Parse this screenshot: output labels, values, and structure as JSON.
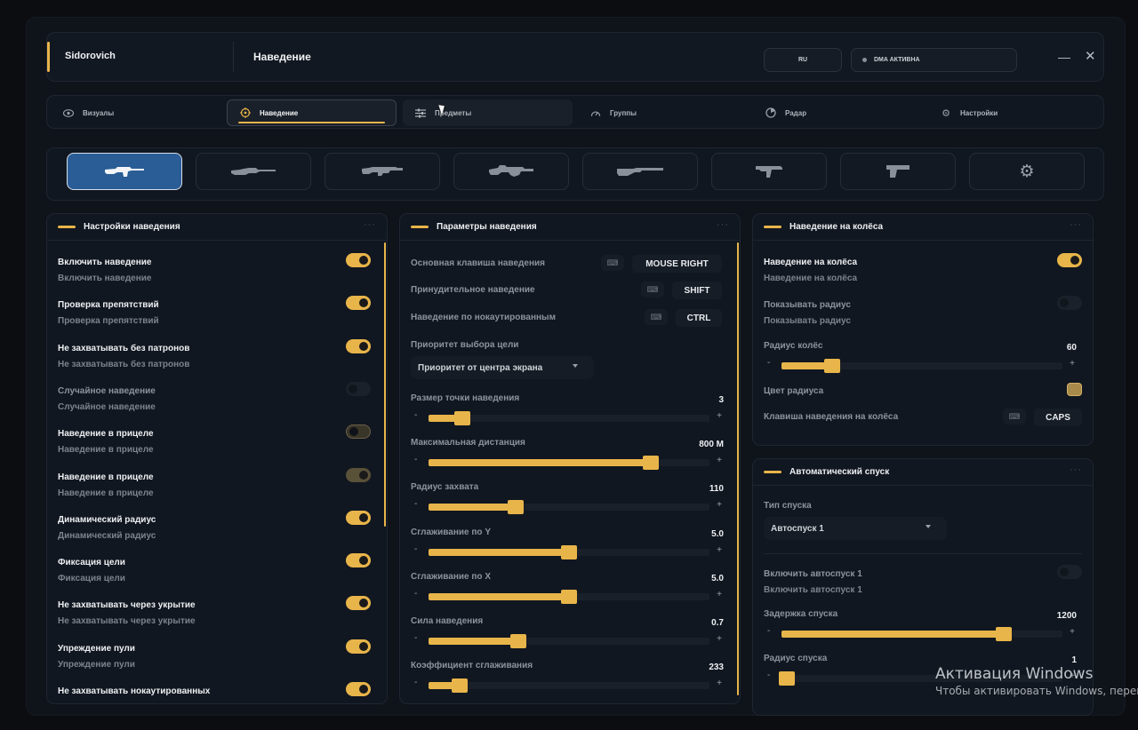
{
  "app": {
    "brand": "Sidorovich",
    "page_title": "Наведение"
  },
  "header": {
    "lang": "RU",
    "dma_status": "DMA АКТИВНА",
    "minimize": "—",
    "close": "✕"
  },
  "nav": [
    {
      "label": "Визуалы",
      "icon": "eye-icon"
    },
    {
      "label": "Наведение",
      "icon": "crosshair-icon"
    },
    {
      "label": "Предметы",
      "icon": "sliders-icon"
    },
    {
      "label": "Группы",
      "icon": "gauge-icon"
    },
    {
      "label": "Радар",
      "icon": "radar-icon"
    },
    {
      "label": "Настройки",
      "icon": "gear-icon"
    }
  ],
  "weapons": [
    "assault-rifle-icon",
    "sniper-rifle-icon",
    "shotgun-icon",
    "machine-gun-icon",
    "long-rifle-icon",
    "smg-icon",
    "pistol-icon",
    "gear-icon"
  ],
  "aim_settings": {
    "title": "Настройки наведения",
    "items": [
      {
        "title": "Включить наведение",
        "subtitle": "Включить наведение",
        "state": "on"
      },
      {
        "title": "Проверка препятствий",
        "subtitle": "Проверка препятствий",
        "state": "on"
      },
      {
        "title": "Не захватывать без патронов",
        "subtitle": "Не захватывать без патронов",
        "state": "on"
      },
      {
        "title": "Случайное наведение",
        "subtitle": "Случайное наведение",
        "state": "off"
      },
      {
        "title": "Наведение в прицеле",
        "subtitle": "Наведение в прицеле",
        "state": "mid"
      },
      {
        "title": "Наведение в прицеле",
        "subtitle": "Наведение в прицеле",
        "state": "mid2"
      },
      {
        "title": "Динамический радиус",
        "subtitle": "Динамический радиус",
        "state": "on"
      },
      {
        "title": "Фиксация цели",
        "subtitle": "Фиксация цели",
        "state": "on"
      },
      {
        "title": "Не захватывать через укрытие",
        "subtitle": "Не захватывать через укрытие",
        "state": "on"
      },
      {
        "title": "Упреждение пули",
        "subtitle": "Упреждение пули",
        "state": "on"
      },
      {
        "title": "Не захватывать нокаутированных",
        "subtitle": "",
        "state": "on"
      }
    ]
  },
  "aim_params": {
    "title": "Параметры наведения",
    "keys": [
      {
        "label": "Основная клавиша наведения",
        "value": "MOUSE RIGHT"
      },
      {
        "label": "Принудительное наведение",
        "value": "SHIFT"
      },
      {
        "label": "Наведение по нокаутированным",
        "value": "CTRL"
      }
    ],
    "priority_label": "Приоритет выбора цели",
    "priority_value": "Приоритет от центра экрана",
    "sliders": [
      {
        "label": "Размер точки наведения",
        "value": "3",
        "level": 0.12
      },
      {
        "label": "Максимальная дистанция",
        "value": "800 M",
        "level": 0.79
      },
      {
        "label": "Радиус захвата",
        "value": "110",
        "level": 0.31
      },
      {
        "label": "Сглаживание по Y",
        "value": "5.0",
        "level": 0.5
      },
      {
        "label": "Сглаживание по X",
        "value": "5.0",
        "level": 0.5
      },
      {
        "label": "Сила наведения",
        "value": "0.7",
        "level": 0.32
      },
      {
        "label": "Коэффициент сглаживания",
        "value": "233",
        "level": 0.11
      }
    ]
  },
  "wheel": {
    "title": "Наведение на колёса",
    "enable_title": "Наведение на колёса",
    "enable_subtitle": "Наведение на колёса",
    "show_title": "Показывать радиус",
    "show_subtitle": "Показывать радиус",
    "radius_label": "Радиус колёс",
    "radius_value": "60",
    "radius_level": 0.18,
    "color_label": "Цвет радиуса",
    "color": "#a88a4a",
    "key_label": "Клавиша наведения на колёса",
    "key_value": "CAPS"
  },
  "trigger": {
    "title": "Автоматический спуск",
    "type_label": "Тип спуска",
    "type_value": "Автоспуск 1",
    "enable_title": "Включить автоспуск 1",
    "enable_subtitle": "Включить автоспуск 1",
    "delay_label": "Задержка спуска",
    "delay_value": "1200",
    "delay_level": 0.79,
    "radius_label": "Радиус спуска",
    "radius_value": "1",
    "radius_level": 0.02
  },
  "watermark": {
    "line1": "Активация Windows",
    "line2": "Чтобы активировать Windows, перей"
  },
  "colors": {
    "accent": "#e8b54a",
    "panel": "#111720",
    "active_weapon": "#2a5c96"
  }
}
